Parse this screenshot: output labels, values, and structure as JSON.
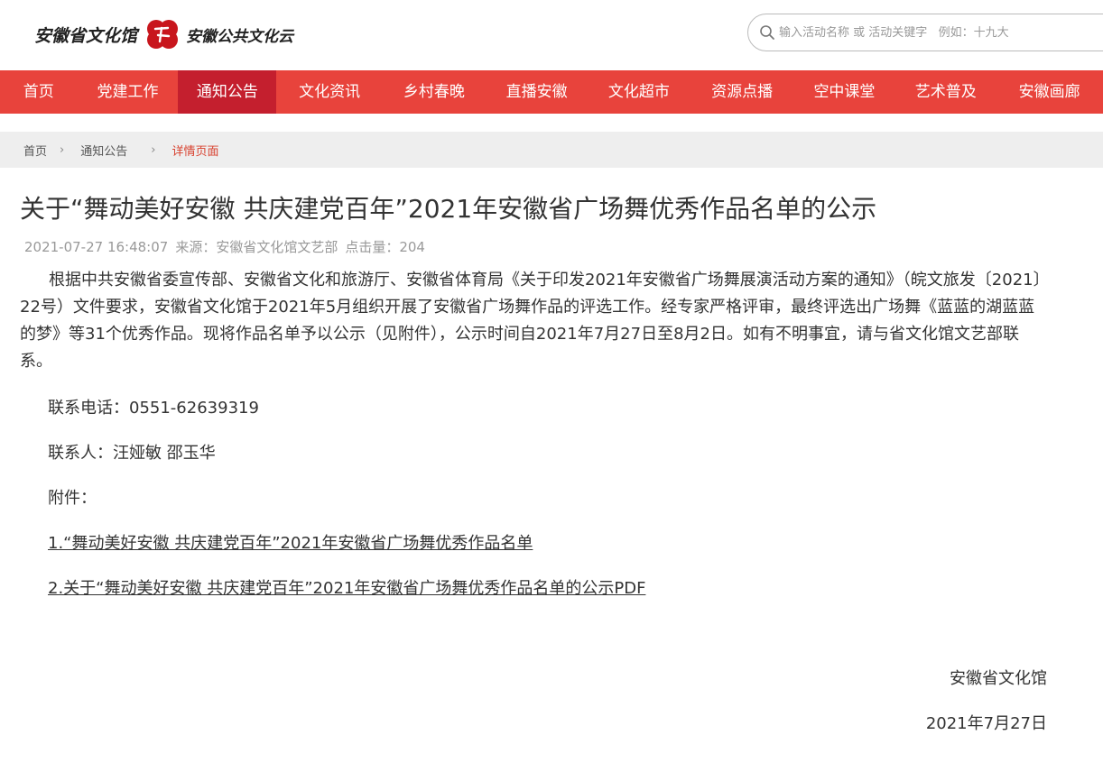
{
  "header": {
    "logo_text_left": "安徽省文化馆",
    "logo_text_right": "安徽公共文化云"
  },
  "search": {
    "placeholder": "输入活动名称 或 活动关键字   例如：十九大"
  },
  "nav": {
    "items": [
      {
        "label": "首页"
      },
      {
        "label": "党建工作"
      },
      {
        "label": "通知公告"
      },
      {
        "label": "文化资讯"
      },
      {
        "label": "乡村春晚"
      },
      {
        "label": "直播安徽"
      },
      {
        "label": "文化超市"
      },
      {
        "label": "资源点播"
      },
      {
        "label": "空中课堂"
      },
      {
        "label": "艺术普及"
      },
      {
        "label": "安徽画廊"
      }
    ],
    "active": "通知公告"
  },
  "breadcrumb": {
    "items": [
      "首页",
      "通知公告",
      "详情页面"
    ]
  },
  "article": {
    "title": "关于“舞动美好安徽 共庆建党百年”2021年安徽省广场舞优秀作品名单的公示",
    "date": "2021-07-27 16:48:07",
    "source": "来源：安徽省文化馆文艺部",
    "clicks": "点击量：204",
    "paragraph": "根据中共安徽省委宣传部、安徽省文化和旅游厅、安徽省体育局《关于印发2021年安徽省广场舞展演活动方案的通知》（皖文旅发〔2021〕22号）文件要求，安徽省文化馆于2021年5月组织开展了安徽省广场舞作品的评选工作。经专家严格评审，最终评选出广场舞《蓝蓝的湖蓝蓝的梦》等31个优秀作品。现将作品名单予以公示（见附件），公示时间自2021年7月27日至8月2日。如有不明事宜，请与省文化馆文艺部联系。",
    "phone": "联系电话：0551-62639319",
    "contact": "联系人：汪娅敏  邵玉华",
    "attachments_label": "附件：",
    "attachment1": "1.“舞动美好安徽 共庆建党百年”2021年安徽省广场舞优秀作品名单",
    "attachment2": "2.关于“舞动美好安徽 共庆建党百年”2021年安徽省广场舞优秀作品名单的公示PDF",
    "sign_org": "安徽省文化馆",
    "sign_date": "2021年7月27日"
  },
  "colors": {
    "nav_bg": "#e8433c",
    "nav_active": "#c41f2e",
    "crumb_current": "#d8412f"
  }
}
